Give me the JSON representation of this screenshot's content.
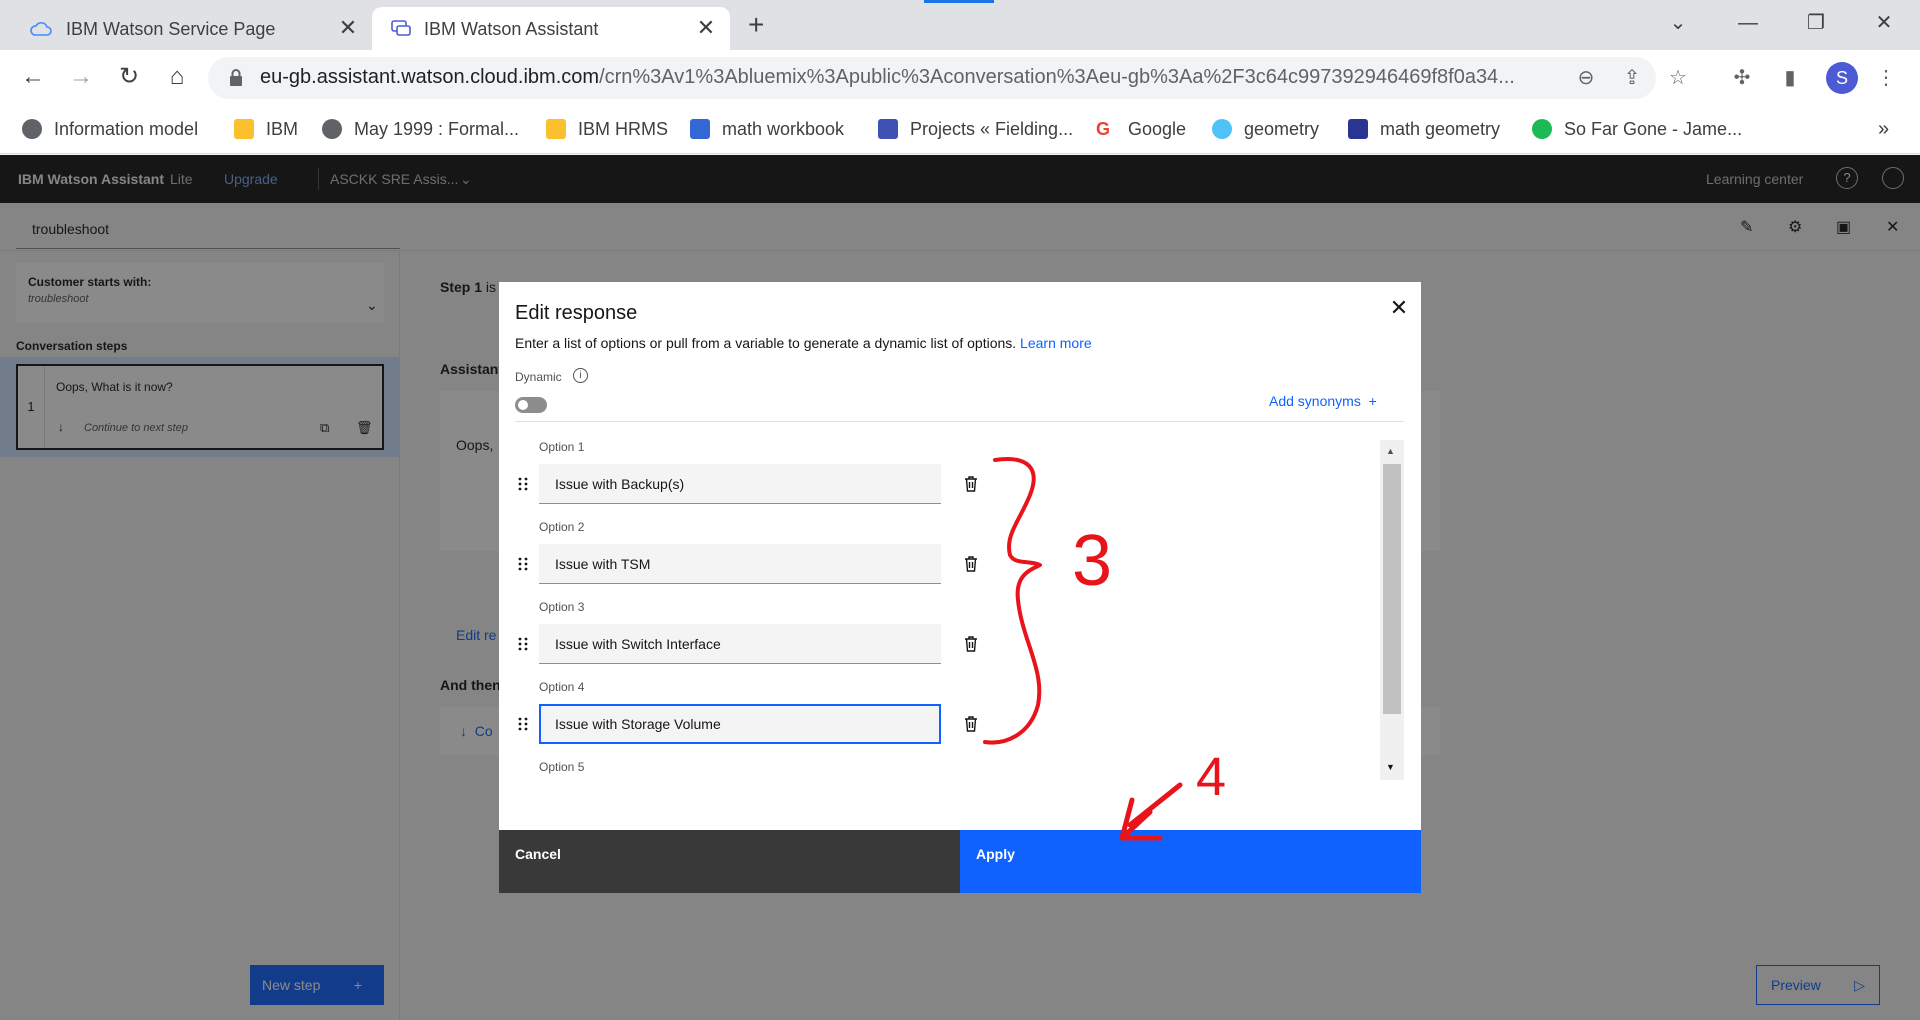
{
  "browser": {
    "tabs": [
      {
        "title": "IBM Watson Service Page",
        "icon": "cloud-icon"
      },
      {
        "title": "IBM Watson Assistant",
        "icon": "chat-icon"
      }
    ],
    "url_main": "eu-gb.assistant.watson.cloud.ibm.com",
    "url_rest": "/crn%3Av1%3Abluemix%3Apublic%3Aconversation%3Aeu-gb%3Aa%2F3c64c997392946469f8f0a34...",
    "profile_initial": "S",
    "bookmarks": [
      {
        "label": "Information model",
        "color": "#5f6368"
      },
      {
        "label": "IBM",
        "color": "#fbc02d"
      },
      {
        "label": "May 1999 : Formal...",
        "color": "#5f6368"
      },
      {
        "label": "IBM HRMS",
        "color": "#fbc02d"
      },
      {
        "label": "math workbook",
        "color": "#3367d6"
      },
      {
        "label": "Projects « Fielding...",
        "color": "#3f51b5"
      },
      {
        "label": "Google",
        "color": "#ea4335"
      },
      {
        "label": "geometry",
        "color": "#4fc3f7"
      },
      {
        "label": "math geometry",
        "color": "#283593"
      },
      {
        "label": "So Far Gone - Jame...",
        "color": "#1db954"
      }
    ]
  },
  "app": {
    "brand": "IBM Watson Assistant",
    "plan": "Lite",
    "upgrade": "Upgrade",
    "assistant_name": "ASCKK SRE Assis...",
    "learning_center": "Learning center",
    "action_name": "troubleshoot",
    "customer_starts_label": "Customer starts with:",
    "customer_starts_value": "troubleshoot",
    "conversation_steps_label": "Conversation steps",
    "step_number": "1",
    "step_text": "Oops, What is it now?",
    "step_next": "Continue to next step",
    "new_step": "New step",
    "preview": "Preview",
    "step1_label": "Step 1",
    "step1_suffix": "is",
    "assistant_label": "Assistant",
    "assistant_text": "Oops,",
    "edit_re": "Edit re",
    "and_then": "And then",
    "co": "Co"
  },
  "modal": {
    "title": "Edit response",
    "description": "Enter a list of options or pull from a variable to generate a dynamic list of options.",
    "learn_more": "Learn more",
    "dynamic_label": "Dynamic",
    "add_synonyms": "Add synonyms",
    "options": [
      {
        "label": "Option 1",
        "value": "Issue with Backup(s)"
      },
      {
        "label": "Option 2",
        "value": "Issue with TSM"
      },
      {
        "label": "Option 3",
        "value": "Issue with Switch Interface"
      },
      {
        "label": "Option 4",
        "value": "Issue with Storage Volume"
      }
    ],
    "option5_label": "Option 5",
    "cancel": "Cancel",
    "apply": "Apply"
  },
  "annotations": {
    "brace_label": "3",
    "arrow_label": "4",
    "color": "#e8141b"
  }
}
